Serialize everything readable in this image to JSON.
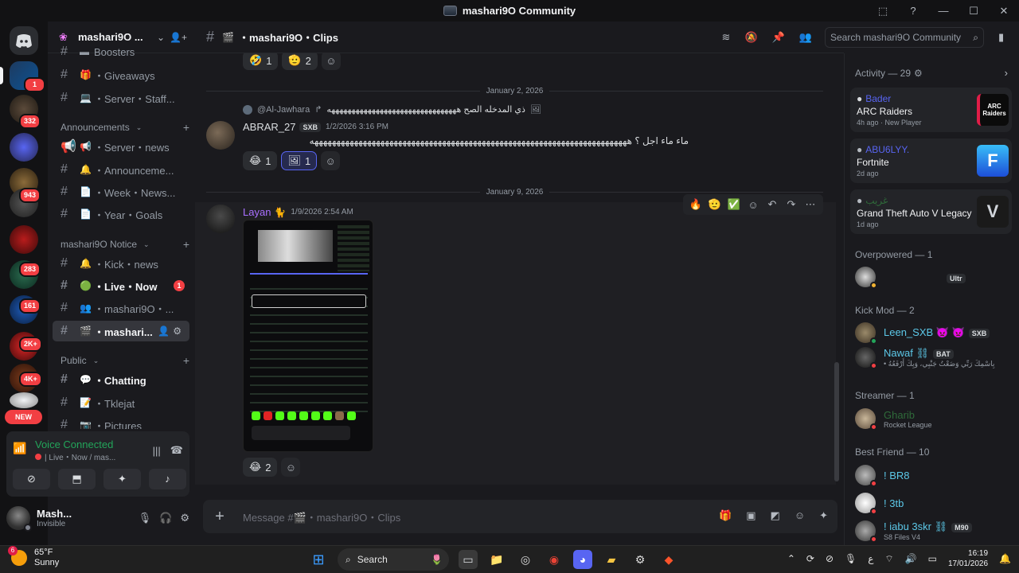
{
  "window": {
    "title": "mashari9O Community"
  },
  "server": {
    "name": "mashari9O ..."
  },
  "rail": {
    "badges": [
      "1",
      "332",
      "943",
      "283",
      "161",
      "2K+",
      "4K+"
    ],
    "new_label": "NEW"
  },
  "sidebar": {
    "top_partial": "Boosters",
    "channels_a": [
      {
        "emoji": "🎁",
        "label": "・Giveaways"
      },
      {
        "emoji": "💻",
        "label": "・Server・Staff..."
      }
    ],
    "cat_announcements": "Announcements",
    "channels_b": [
      {
        "emoji": "📢",
        "label": "・Server・news"
      },
      {
        "emoji": "🔔",
        "label": "・Announceme..."
      },
      {
        "emoji": "📄",
        "label": "・Week・News..."
      },
      {
        "emoji": "📄",
        "label": "・Year・Goals"
      }
    ],
    "cat_notice": "mashari9O Notice",
    "channels_c": [
      {
        "emoji": "🔔",
        "label": "・Kick・news"
      },
      {
        "emoji": "🟢",
        "label": "・Live・Now",
        "mention": "1"
      },
      {
        "emoji": "👥",
        "label": "・mashari9O・..."
      },
      {
        "emoji": "🎬",
        "label": "・mashari..."
      }
    ],
    "cat_public": "Public",
    "channels_d": [
      {
        "emoji": "💬",
        "label": "・Chatting"
      },
      {
        "emoji": "📝",
        "label": "・Tklejat"
      },
      {
        "emoji": "📷",
        "label": "・Pictures"
      }
    ]
  },
  "voice": {
    "status": "Voice Connected",
    "where": "| Live・Now / mas..."
  },
  "user": {
    "name": "Mash...",
    "status": "Invisible"
  },
  "channel": {
    "name": "・mashari9O・Clips"
  },
  "search": {
    "placeholder": "Search mashari9O Community"
  },
  "messages": {
    "top_reacts": [
      {
        "emoji": "🤣",
        "count": "1"
      },
      {
        "emoji": "🫡",
        "count": "2"
      }
    ],
    "date1": "January 2, 2026",
    "reply_to": "@Al-Jawhara",
    "reply_text": "ذي المدخله الصح ههههههههههههههههههههههههههههههههه",
    "msg1": {
      "author": "ABRAR_27",
      "tag": "SXB",
      "time": "1/2/2026 3:16 PM",
      "text": "ماء ماء اجل ؟ ههههههههههههههههههههههههههههههههههههههههههههههههههههههههههههههههههههههههه",
      "reacts": [
        {
          "emoji": "😂",
          "count": "1"
        },
        {
          "emoji": "🖼",
          "count": "1"
        }
      ]
    },
    "date2": "January 9, 2026",
    "msg2": {
      "author": "Layan",
      "time": "1/9/2026 2:54 AM",
      "reacts": [
        {
          "emoji": "😂",
          "count": "2"
        }
      ]
    },
    "hover_actions": [
      "🔥",
      "🫡",
      "✅"
    ]
  },
  "composer": {
    "placeholder": "Message #🎬・mashari9O・Clips"
  },
  "members": {
    "activity_header": "Activity — 29",
    "activities": [
      {
        "user": "Bader",
        "game": "ARC Raiders",
        "meta": "4h ago · New Player",
        "img": "ARC Raiders"
      },
      {
        "user": "ABU6LYY.",
        "game": "Fortnite",
        "meta": "2d ago",
        "img": "F"
      },
      {
        "user": "غريب",
        "game": "Grand Theft Auto V Legacy",
        "meta": "1d ago",
        "img": "V"
      }
    ],
    "overpowered_header": "Overpowered — 1",
    "overpowered": [
      {
        "name": "",
        "tag": "Ultr"
      }
    ],
    "kickmod_header": "Kick Mod — 2",
    "kickmod": [
      {
        "name": "Leen_SXB 👿 👿",
        "tag": "SXB",
        "sub": ""
      },
      {
        "name": "Nawaf ⛓",
        "tag": "BAT",
        "sub": "• بِاسْمِكَ رَبِّي وَضَعْتُ جَنْبِي، وَبِكَ أَرْفَعُهُ"
      }
    ],
    "streamer_header": "Streamer — 1",
    "streamer": [
      {
        "name": "Gharib",
        "sub": "Rocket League"
      }
    ],
    "bestfriend_header": "Best Friend — 10",
    "bestfriend": [
      {
        "name": "! BR8",
        "sub": ""
      },
      {
        "name": "! 3tb",
        "sub": ""
      },
      {
        "name": "! iabu 3skr ⛓",
        "tag": "M90",
        "sub": "S8 Files V4"
      }
    ]
  },
  "taskbar": {
    "weather_temp": "65°F",
    "weather_desc": "Sunny",
    "weather_badge": "6",
    "search": "Search",
    "time": "16:19",
    "date": "17/01/2026",
    "lang": "ع"
  }
}
